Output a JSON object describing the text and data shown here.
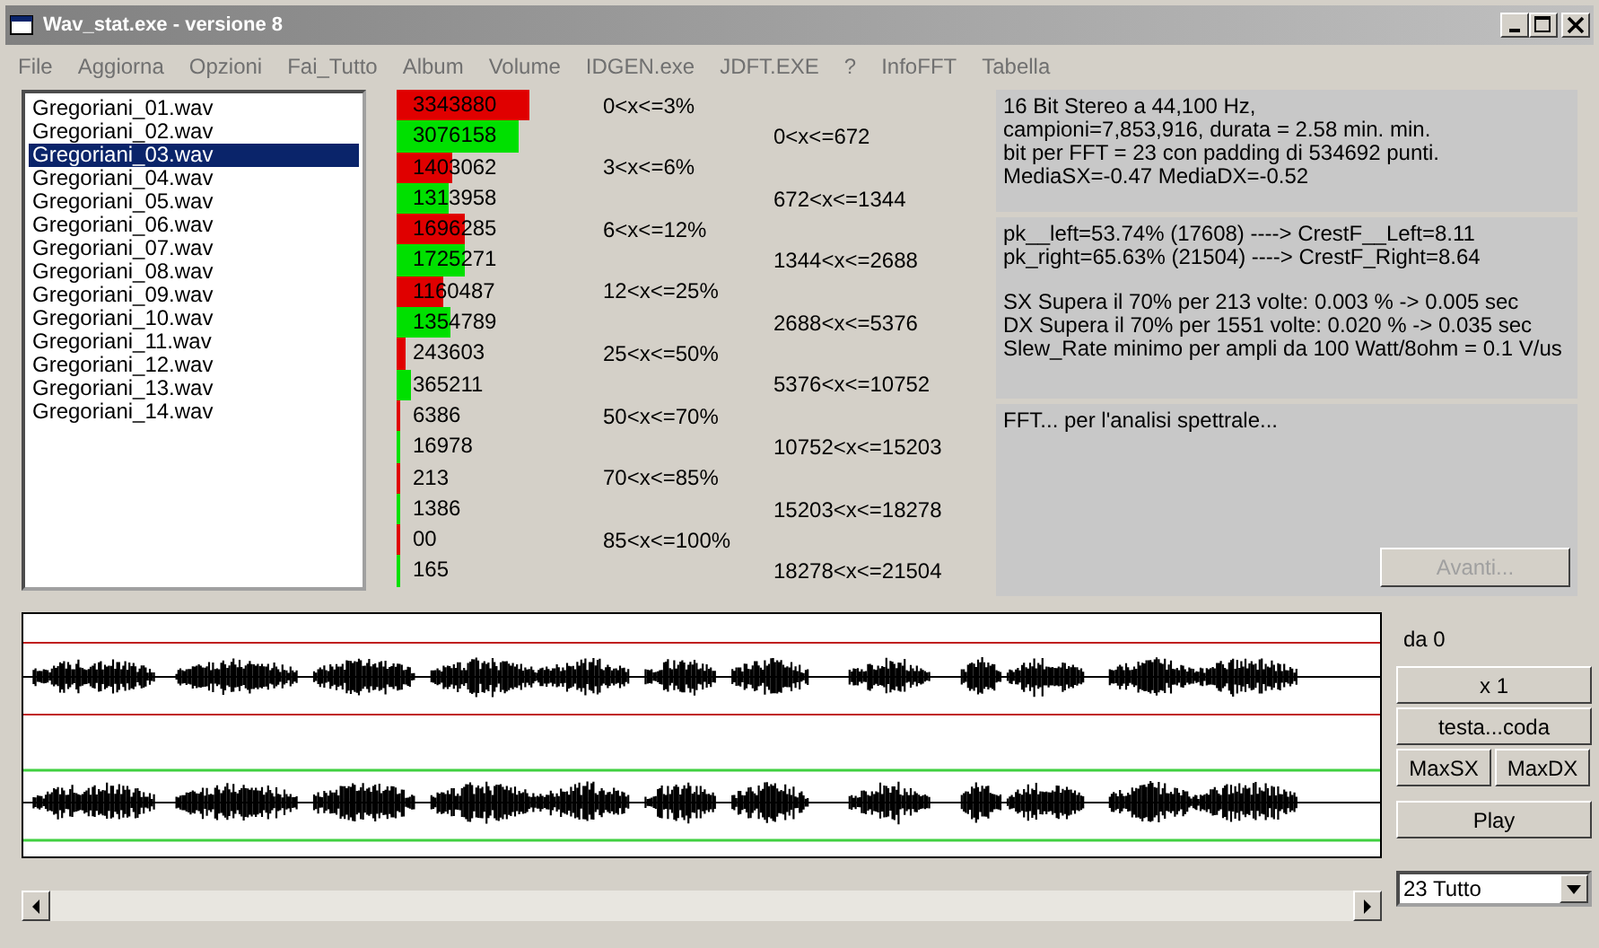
{
  "window": {
    "title": "Wav_stat.exe - versione 8"
  },
  "menu": [
    "File",
    "Aggiorna",
    "Opzioni",
    "Fai_Tutto",
    "Album",
    "Volume",
    "IDGEN.exe",
    "JDFT.EXE",
    "?",
    "InfoFFT",
    "Tabella"
  ],
  "files": [
    {
      "name": "Gregoriani_01.wav",
      "selected": false
    },
    {
      "name": "Gregoriani_02.wav",
      "selected": false
    },
    {
      "name": "Gregoriani_03.wav",
      "selected": true
    },
    {
      "name": "Gregoriani_04.wav",
      "selected": false
    },
    {
      "name": "Gregoriani_05.wav",
      "selected": false
    },
    {
      "name": "Gregoriani_06.wav",
      "selected": false
    },
    {
      "name": "Gregoriani_07.wav",
      "selected": false
    },
    {
      "name": "Gregoriani_08.wav",
      "selected": false
    },
    {
      "name": "Gregoriani_09.wav",
      "selected": false
    },
    {
      "name": "Gregoriani_10.wav",
      "selected": false
    },
    {
      "name": "Gregoriani_11.wav",
      "selected": false
    },
    {
      "name": "Gregoriani_12.wav",
      "selected": false
    },
    {
      "name": "Gregoriani_13.wav",
      "selected": false
    },
    {
      "name": "Gregoriani_14.wav",
      "selected": false
    }
  ],
  "histogram": [
    {
      "value": "3343880",
      "kind": "left",
      "color": "#e00000",
      "label": "0<x<=3%"
    },
    {
      "value": "3076158",
      "kind": "right",
      "color": "#00e000",
      "label": "0<x<=672"
    },
    {
      "value": "1403062",
      "kind": "left",
      "color": "#e00000",
      "label": "3<x<=6%"
    },
    {
      "value": "1313958",
      "kind": "right",
      "color": "#00e000",
      "label": "672<x<=1344"
    },
    {
      "value": "1696285",
      "kind": "left",
      "color": "#e00000",
      "label": "6<x<=12%"
    },
    {
      "value": "1725271",
      "kind": "right",
      "color": "#00e000",
      "label": "1344<x<=2688"
    },
    {
      "value": "1160487",
      "kind": "left",
      "color": "#e00000",
      "label": "12<x<=25%"
    },
    {
      "value": "1354789",
      "kind": "right",
      "color": "#00e000",
      "label": "2688<x<=5376"
    },
    {
      "value": "243603",
      "kind": "left",
      "color": "#e00000",
      "label": "25<x<=50%"
    },
    {
      "value": "365211",
      "kind": "right",
      "color": "#00e000",
      "label": "5376<x<=10752"
    },
    {
      "value": "6386",
      "kind": "left",
      "color": "#e00000",
      "label": "50<x<=70%"
    },
    {
      "value": "16978",
      "kind": "right",
      "color": "#00e000",
      "label": "10752<x<=15203"
    },
    {
      "value": "213",
      "kind": "left",
      "color": "#e00000",
      "label": "70<x<=85%"
    },
    {
      "value": "1386",
      "kind": "right",
      "color": "#00e000",
      "label": "15203<x<=18278"
    },
    {
      "value": "00",
      "kind": "left",
      "color": "#e00000",
      "label": "85<x<=100%"
    },
    {
      "value": "165",
      "kind": "right",
      "color": "#00e000",
      "label": "18278<x<=21504"
    }
  ],
  "panels": [
    {
      "paragraphs": [
        [
          "16 Bit Stereo a 44,100 Hz,",
          "campioni=7,853,916, durata = 2.58 min. min.",
          "bit per FFT = 23 con padding di 534692 punti.",
          "MediaSX=-0.47  MediaDX=-0.52"
        ]
      ]
    },
    {
      "paragraphs": [
        [
          "pk__left=53.74% (17608) ----> CrestF__Left=8.11",
          "pk_right=65.63% (21504) ----> CrestF_Right=8.64"
        ],
        [
          "SX Supera il 70% per 213 volte: 0.003 % -> 0.005 sec",
          "DX Supera il 70% per 1551 volte: 0.020 %  -> 0.035 sec",
          "Slew_Rate minimo per ampli da 100 Watt/8ohm = 0.1 V/us"
        ]
      ]
    },
    {
      "paragraphs": [
        [
          "FFT... per l'analisi spettrale..."
        ]
      ],
      "button": {
        "label": "Avanti...",
        "disabled": true
      }
    }
  ],
  "controls": {
    "position": "da 0",
    "zoom_button": "x 1",
    "range_button": "testa...coda",
    "max_buttons": [
      "MaxSX",
      "MaxDX"
    ],
    "play_button": "Play",
    "selector": "23 Tutto"
  }
}
